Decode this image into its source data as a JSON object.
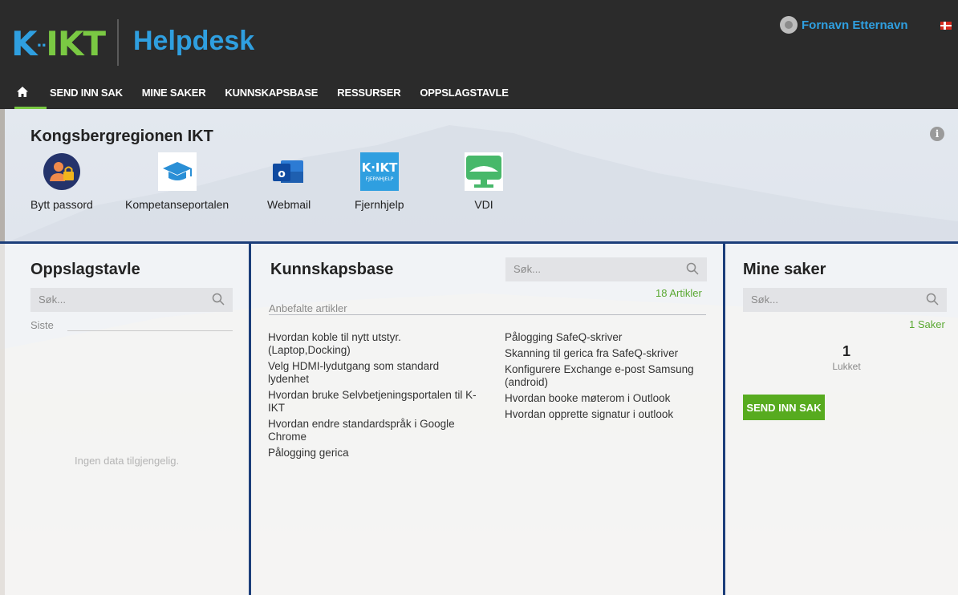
{
  "header": {
    "logo_prefix": "K",
    "logo_dots": "··",
    "logo_main": "IKT",
    "app_title": "Helpdesk",
    "user_name": "Fornavn Etternavn",
    "flag_icon": "norway-flag-icon"
  },
  "nav": {
    "home_icon": "home-icon",
    "items": [
      {
        "label": "SEND INN SAK"
      },
      {
        "label": "MINE SAKER"
      },
      {
        "label": "KUNNSKAPSBASE"
      },
      {
        "label": "RESSURSER"
      },
      {
        "label": "OPPSLAGSTAVLE"
      }
    ]
  },
  "apps": {
    "title": "Kongsbergregionen IKT",
    "info_glyph": "i",
    "items": [
      {
        "label": "Bytt passord",
        "icon": "password-user-icon"
      },
      {
        "label": "Kompetanseportalen",
        "icon": "graduation-cap-icon"
      },
      {
        "label": "Webmail",
        "icon": "outlook-icon"
      },
      {
        "label": "Fjernhjelp",
        "icon": "kikt-fjernhjelp-icon"
      },
      {
        "label": "VDI",
        "icon": "vdi-monitor-icon"
      }
    ],
    "fjernhjelp_icon_text": "K·IKT",
    "fjernhjelp_icon_subtext": "FJERNHJELP",
    "webmail_icon_letter": "o"
  },
  "oppslagstavle": {
    "title": "Oppslagstavle",
    "search_placeholder": "Søk...",
    "recent_label": "Siste",
    "empty_text": "Ingen data tilgjengelig."
  },
  "kunnskapsbase": {
    "title": "Kunnskapsbase",
    "search_placeholder": "Søk...",
    "count_text": "18 Artikler",
    "recommended_label": "Anbefalte artikler",
    "articles_left": [
      "Hvordan koble til nytt utstyr. (Laptop,Docking)",
      "Velg HDMI-lydutgang som standard lydenhet",
      "Hvordan bruke Selvbetjeningsportalen til K-IKT",
      "Hvordan endre standardspråk i Google Chrome",
      "Pålogging gerica"
    ],
    "articles_right": [
      "Pålogging SafeQ-skriver",
      "Skanning til gerica fra SafeQ-skriver",
      "Konfigurere Exchange e-post Samsung (android)",
      "Hvordan booke møterom i Outlook",
      "Hvordan opprette signatur i outlook"
    ]
  },
  "mine_saker": {
    "title": "Mine saker",
    "search_placeholder": "Søk...",
    "count_text": "1 Saker",
    "closed_count": "1",
    "closed_label": "Lukket",
    "button_label": "SEND INN SAK"
  },
  "colors": {
    "accent_blue": "#2f9fe0",
    "accent_green": "#7ac943",
    "button_green": "#57ab1f",
    "panel_border": "#1c3e7a",
    "topbar": "#2b2b2b"
  }
}
